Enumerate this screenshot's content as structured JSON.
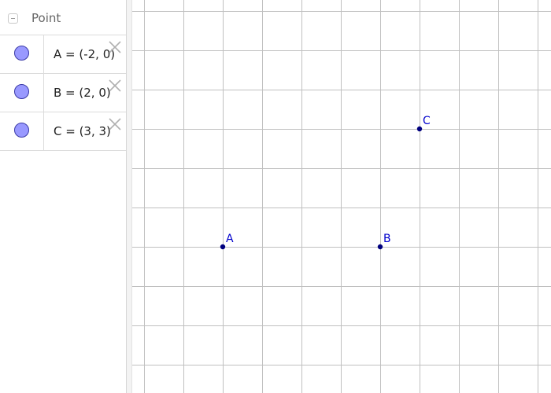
{
  "algebra": {
    "group_title": "Point",
    "rows": [
      {
        "text": "A = (-2, 0)"
      },
      {
        "text": "B = (2, 0)"
      },
      {
        "text": "C = (3, 3)"
      }
    ]
  },
  "graphics": {
    "grid": true,
    "grid_color": "#c0c0c0",
    "point_color": "#00007f",
    "label_color": "#0000cc",
    "points": [
      {
        "label": "A",
        "x": -2,
        "y": 0
      },
      {
        "label": "B",
        "x": 2,
        "y": 0
      },
      {
        "label": "C",
        "x": 3,
        "y": 3
      }
    ]
  },
  "colors": {
    "dot_fill": "#9999ff",
    "dot_stroke": "#3a3aa6"
  }
}
